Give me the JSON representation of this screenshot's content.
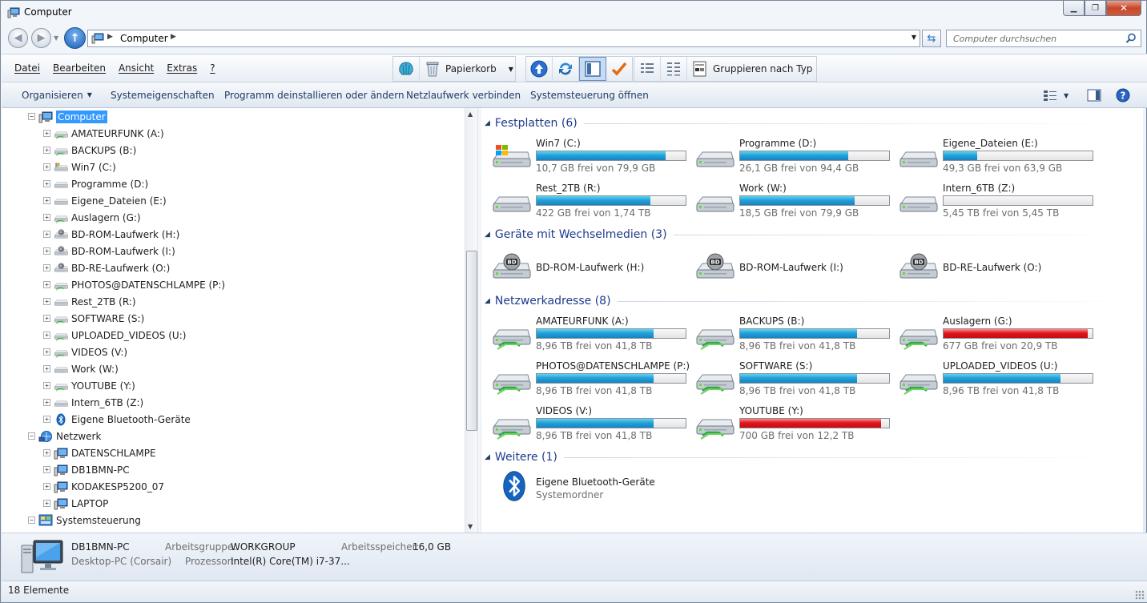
{
  "window": {
    "title": "Computer"
  },
  "address": {
    "crumb": "Computer",
    "search_placeholder": "Computer durchsuchen"
  },
  "menu": [
    "Datei",
    "Bearbeiten",
    "Ansicht",
    "Extras",
    "?"
  ],
  "toolbar": {
    "recycle_label": "Papierkorb",
    "group_label": "Gruppieren nach Typ"
  },
  "commands": [
    "Organisieren",
    "Systemeigenschaften",
    "Programm deinstallieren oder ändern",
    "Netzlaufwerk verbinden",
    "Systemsteuerung öffnen"
  ],
  "tree": [
    {
      "label": "Computer",
      "level": 0,
      "icon": "computer-icon",
      "expanded": true,
      "selected": true
    },
    {
      "label": "AMATEURFUNK (A:)",
      "level": 1,
      "icon": "network-drive-icon"
    },
    {
      "label": "BACKUPS (B:)",
      "level": 1,
      "icon": "network-drive-icon"
    },
    {
      "label": "Win7 (C:)",
      "level": 1,
      "icon": "windows-drive-icon"
    },
    {
      "label": "Programme (D:)",
      "level": 1,
      "icon": "hard-drive-icon"
    },
    {
      "label": "Eigene_Dateien (E:)",
      "level": 1,
      "icon": "hard-drive-icon"
    },
    {
      "label": "Auslagern (G:)",
      "level": 1,
      "icon": "network-drive-icon"
    },
    {
      "label": "BD-ROM-Laufwerk (H:)",
      "level": 1,
      "icon": "bd-drive-icon"
    },
    {
      "label": "BD-ROM-Laufwerk (I:)",
      "level": 1,
      "icon": "bd-drive-icon"
    },
    {
      "label": "BD-RE-Laufwerk (O:)",
      "level": 1,
      "icon": "bd-drive-icon"
    },
    {
      "label": "PHOTOS@DATENSCHLAMPE (P:)",
      "level": 1,
      "icon": "network-drive-icon"
    },
    {
      "label": "Rest_2TB (R:)",
      "level": 1,
      "icon": "hard-drive-icon"
    },
    {
      "label": "SOFTWARE (S:)",
      "level": 1,
      "icon": "network-drive-icon"
    },
    {
      "label": "UPLOADED_VIDEOS (U:)",
      "level": 1,
      "icon": "network-drive-icon"
    },
    {
      "label": "VIDEOS (V:)",
      "level": 1,
      "icon": "network-drive-icon"
    },
    {
      "label": "Work (W:)",
      "level": 1,
      "icon": "hard-drive-icon"
    },
    {
      "label": "YOUTUBE (Y:)",
      "level": 1,
      "icon": "network-drive-icon"
    },
    {
      "label": "Intern_6TB (Z:)",
      "level": 1,
      "icon": "hard-drive-icon"
    },
    {
      "label": "Eigene Bluetooth-Geräte",
      "level": 1,
      "icon": "bluetooth-icon"
    },
    {
      "label": "Netzwerk",
      "level": 0,
      "icon": "network-icon",
      "expanded": true
    },
    {
      "label": "DATENSCHLAMPE",
      "level": 1,
      "icon": "computer-icon"
    },
    {
      "label": "DB1BMN-PC",
      "level": 1,
      "icon": "computer-icon"
    },
    {
      "label": "KODAKESP5200_07",
      "level": 1,
      "icon": "computer-icon"
    },
    {
      "label": "LAPTOP",
      "level": 1,
      "icon": "computer-icon"
    },
    {
      "label": "Systemsteuerung",
      "level": 0,
      "icon": "control-panel-icon",
      "expanded": true
    }
  ],
  "groups": [
    {
      "title": "Festplatten (6)",
      "items": [
        {
          "name": "Win7 (C:)",
          "info": "10,7 GB frei von 79,9 GB",
          "used": 0.866,
          "icon": "windows-drive-icon"
        },
        {
          "name": "Programme (D:)",
          "info": "26,1 GB frei von 94,4 GB",
          "used": 0.724,
          "icon": "hard-drive-icon"
        },
        {
          "name": "Eigene_Dateien (E:)",
          "info": "49,3 GB frei von 63,9 GB",
          "used": 0.228,
          "icon": "hard-drive-icon"
        },
        {
          "name": "Rest_2TB (R:)",
          "info": "422 GB frei von 1,74 TB",
          "used": 0.763,
          "icon": "hard-drive-icon"
        },
        {
          "name": "Work (W:)",
          "info": "18,5 GB frei von 79,9 GB",
          "used": 0.768,
          "icon": "hard-drive-icon"
        },
        {
          "name": "Intern_6TB (Z:)",
          "info": "5,45 TB frei von 5,45 TB",
          "used": 0.0,
          "icon": "hard-drive-icon"
        }
      ]
    },
    {
      "title": "Geräte mit Wechselmedien (3)",
      "items": [
        {
          "name": "BD-ROM-Laufwerk (H:)",
          "icon": "bd-drive-icon"
        },
        {
          "name": "BD-ROM-Laufwerk (I:)",
          "icon": "bd-drive-icon"
        },
        {
          "name": "BD-RE-Laufwerk (O:)",
          "icon": "bd-drive-icon"
        }
      ]
    },
    {
      "title": "Netzwerkadresse (8)",
      "items": [
        {
          "name": "AMATEURFUNK (A:)",
          "info": "8,96 TB frei von 41,8 TB",
          "used": 0.786,
          "icon": "network-drive-icon"
        },
        {
          "name": "BACKUPS (B:)",
          "info": "8,96 TB frei von 41,8 TB",
          "used": 0.786,
          "icon": "network-drive-icon"
        },
        {
          "name": "Auslagern (G:)",
          "info": "677 GB frei von 20,9 TB",
          "used": 0.968,
          "icon": "network-drive-icon",
          "warn": true
        },
        {
          "name": "PHOTOS@DATENSCHLAMPE (P:)",
          "info": "8,96 TB frei von 41,8 TB",
          "used": 0.786,
          "icon": "network-drive-icon"
        },
        {
          "name": "SOFTWARE (S:)",
          "info": "8,96 TB frei von 41,8 TB",
          "used": 0.786,
          "icon": "network-drive-icon"
        },
        {
          "name": "UPLOADED_VIDEOS (U:)",
          "info": "8,96 TB frei von 41,8 TB",
          "used": 0.786,
          "icon": "network-drive-icon"
        },
        {
          "name": "VIDEOS (V:)",
          "info": "8,96 TB frei von 41,8 TB",
          "used": 0.786,
          "icon": "network-drive-icon"
        },
        {
          "name": "YOUTUBE (Y:)",
          "info": "700 GB frei von 12,2 TB",
          "used": 0.944,
          "icon": "network-drive-icon",
          "warn": true
        }
      ]
    },
    {
      "title": "Weitere (1)",
      "items": [
        {
          "name": "Eigene Bluetooth-Geräte",
          "info": "Systemordner",
          "icon": "bluetooth-icon"
        }
      ]
    }
  ],
  "details": {
    "name": "DB1BMN-PC",
    "subtitle": "Desktop-PC (Corsair)",
    "workgroup_label": "Arbeitsgruppe:",
    "workgroup_value": "WORKGROUP",
    "memory_label": "Arbeitsspeicher:",
    "memory_value": "16,0 GB",
    "cpu_label": "Prozessor:",
    "cpu_value": "Intel(R) Core(TM) i7-37..."
  },
  "status": {
    "count": "18 Elemente"
  },
  "colors": {
    "selection": "#3399ff",
    "bar_ok": "#26a0da",
    "bar_full": "#e0161c",
    "group_title": "#1e3c8c"
  }
}
